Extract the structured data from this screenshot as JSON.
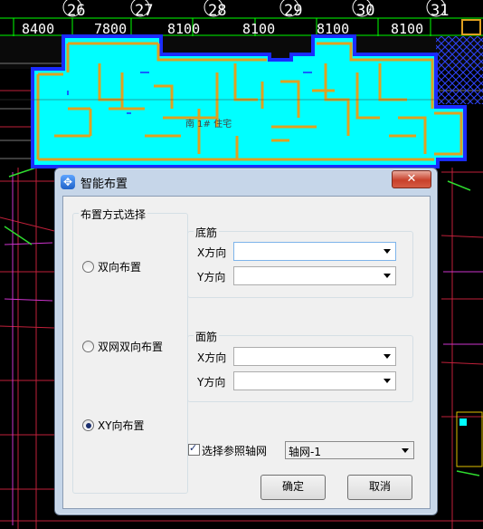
{
  "cad": {
    "axis_numbers": [
      "26",
      "27",
      "28",
      "29",
      "30",
      "31"
    ],
    "dimensions": [
      "8400",
      "7800",
      "8100",
      "8100",
      "8100",
      "8100"
    ],
    "building_label": "南 1# 住宅",
    "colors": {
      "fill": "#00ffff",
      "outline": "#1a2cff",
      "walls": "#e0a020",
      "grid": "#00ff00",
      "background": "#000000"
    }
  },
  "dialog": {
    "title": "智能布置",
    "close_symbol": "✕",
    "layout_group": {
      "title": "布置方式选择",
      "options": [
        {
          "label": "双向布置",
          "checked": false
        },
        {
          "label": "双网双向布置",
          "checked": false
        },
        {
          "label": "XY向布置",
          "checked": true
        }
      ]
    },
    "bottom_bar": {
      "title": "底筋",
      "x_label": "X方向",
      "y_label": "Y方向",
      "x_value": "",
      "y_value": ""
    },
    "top_bar": {
      "title": "面筋",
      "x_label": "X方向",
      "y_label": "Y方向",
      "x_value": "",
      "y_value": ""
    },
    "axis_net": {
      "checkbox_label": "选择参照轴网",
      "checked": true,
      "selected": "轴网-1"
    },
    "ok_label": "确定",
    "cancel_label": "取消"
  }
}
